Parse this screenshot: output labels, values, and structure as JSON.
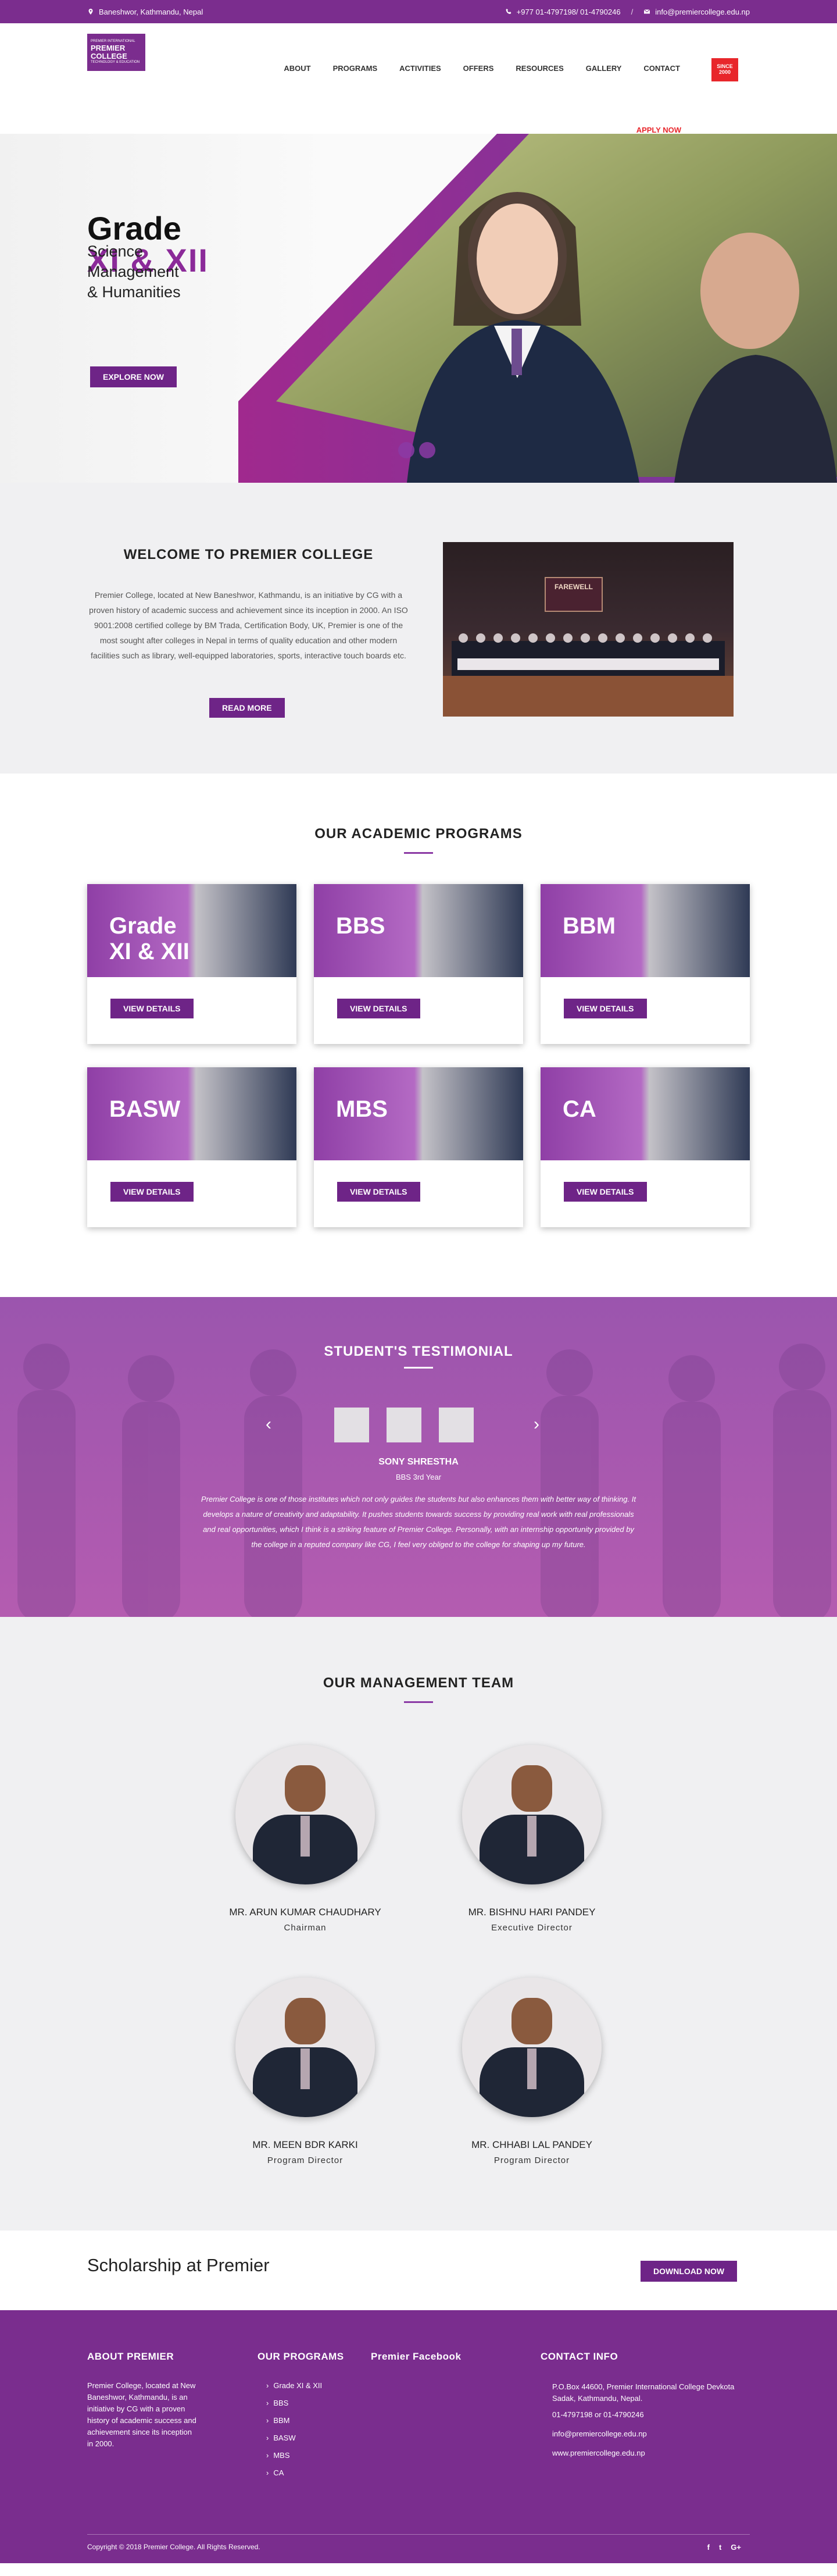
{
  "topbar": {
    "address": "Baneshwor, Kathmandu, Nepal",
    "phone": "+977 01-4797198/ 01-4790246",
    "separator": "/",
    "email": "info@premiercollege.edu.np"
  },
  "logo": {
    "tag": "PREMIER INTERNATIONAL",
    "line1": "PREMIER",
    "line2": "COLLEGE",
    "sub": "TECHNOLOGY & EDUCATION"
  },
  "nav": {
    "items": [
      "ABOUT",
      "PROGRAMS",
      "ACTIVITIES",
      "OFFERS",
      "RESOURCES",
      "GALLERY",
      "CONTACT"
    ],
    "apply": "APPLY NOW",
    "stamp_line1": "SINCE",
    "stamp_line2": "2000"
  },
  "hero": {
    "title": "Grade",
    "title_accent": "XI & XII",
    "streams_line1": "Science",
    "streams_line2": "Management",
    "streams_line3": "& Humanities",
    "cta": "EXPLORE NOW"
  },
  "welcome": {
    "heading": "WELCOME TO PREMIER COLLEGE",
    "body": "Premier College, located at New Baneshwor, Kathmandu, is an initiative by CG with a proven history of academic success and achievement since its inception in 2000. An ISO 9001:2008 certified college by BM Trada, Certification Body, UK, Premier is one of the most sought after colleges in Nepal in terms of quality education and other modern facilities such as library, well-equipped laboratories, sports, interactive touch boards etc.",
    "cta": "READ MORE",
    "photo_banner": "FAREWELL"
  },
  "programs": {
    "heading": "OUR ACADEMIC PROGRAMS",
    "cards": [
      {
        "label": "Grade XI & XII",
        "button": "VIEW DETAILS"
      },
      {
        "label": "BBS",
        "button": "VIEW DETAILS"
      },
      {
        "label": "BBM",
        "button": "VIEW DETAILS"
      },
      {
        "label": "BASW",
        "button": "VIEW DETAILS"
      },
      {
        "label": "MBS",
        "button": "VIEW DETAILS"
      },
      {
        "label": "CA",
        "button": "VIEW DETAILS"
      }
    ]
  },
  "testimonial": {
    "heading": "STUDENT'S TESTIMONIAL",
    "prev": "‹",
    "next": "›",
    "name": "SONY SHRESTHA",
    "role": "BBS 3rd Year",
    "quote": "Premier College is one of those institutes which not only guides the students but also enhances them with better way of thinking. It develops a nature of creativity and adaptability. It pushes students towards success by providing real work with real professionals and real opportunities, which I think is a striking feature of Premier College. Personally, with an internship opportunity provided by the college in a reputed company like CG, I feel very obliged to the college for shaping up my future."
  },
  "management": {
    "heading": "OUR MANAGEMENT TEAM",
    "members": [
      {
        "name": "MR. ARUN KUMAR CHAUDHARY",
        "role": "Chairman"
      },
      {
        "name": "MR. BISHNU HARI PANDEY",
        "role": "Executive Director"
      },
      {
        "name": "MR. MEEN BDR KARKI",
        "role": "Program Director"
      },
      {
        "name": "MR. CHHABI LAL PANDEY",
        "role": "Program Director"
      }
    ]
  },
  "scholarship": {
    "heading": "Scholarship at Premier",
    "cta": "DOWNLOAD NOW"
  },
  "footer": {
    "about_heading": "ABOUT PREMIER",
    "about_text": "Premier College, located at New Baneshwor, Kathmandu, is an initiative by CG with a proven history of academic success and achievement since its inception in 2000.",
    "programs_heading": "OUR PROGRAMS",
    "programs": [
      "Grade XI & XII",
      "BBS",
      "BBM",
      "BASW",
      "MBS",
      "CA"
    ],
    "facebook_heading": "Premier Facebook",
    "contact_heading": "CONTACT INFO",
    "contact_address": "P.O.Box 44600, Premier International College Devkota Sadak, Kathmandu, Nepal.",
    "contact_phone": "01-4797198 or 01-4790246",
    "contact_email": "info@premiercollege.edu.np",
    "contact_web": "www.premiercollege.edu.np",
    "copyright": "Copyright © 2018 Premier College. All Rights Reserved.",
    "social": [
      "f",
      "t",
      "G+"
    ]
  }
}
